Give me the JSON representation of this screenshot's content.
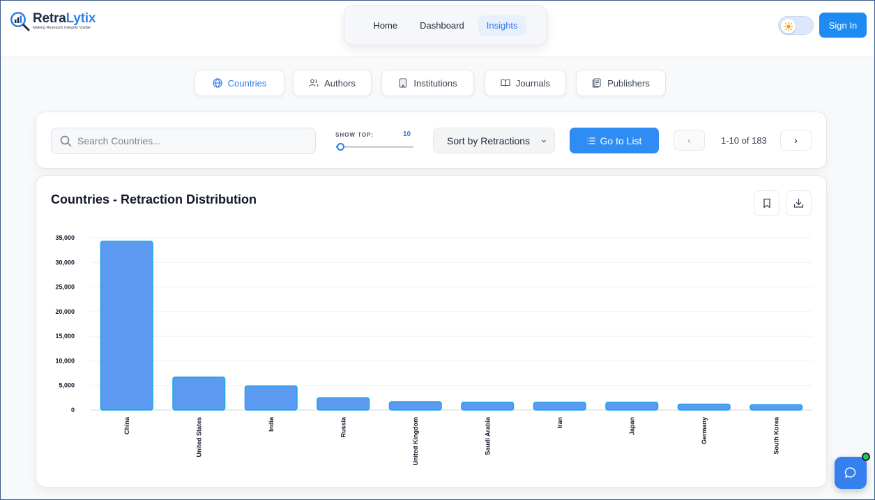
{
  "app": {
    "name_part1": "Retra",
    "name_part2": "Lytix",
    "tagline": "Making Research Integrity Visible"
  },
  "nav": {
    "items": [
      {
        "label": "Home"
      },
      {
        "label": "Dashboard"
      },
      {
        "label": "Insights",
        "active": true
      }
    ]
  },
  "header": {
    "sign_in_label": "Sign In",
    "theme_icon": "sun-icon"
  },
  "tabs": [
    {
      "label": "Countries",
      "icon": "globe-icon",
      "active": true
    },
    {
      "label": "Authors",
      "icon": "users-icon"
    },
    {
      "label": "Institutions",
      "icon": "building-icon"
    },
    {
      "label": "Journals",
      "icon": "book-open-icon"
    },
    {
      "label": "Publishers",
      "icon": "publisher-icon"
    }
  ],
  "controls": {
    "search_placeholder": "Search Countries...",
    "search_value": "",
    "show_top_label": "SHOW TOP:",
    "show_top_value": "10",
    "show_top_fraction": 0.05,
    "sort_label": "Sort by Retractions",
    "go_to_list_label": "Go to List",
    "pagination_info": "1-10 of 183",
    "prev_label": "‹",
    "next_label": "›"
  },
  "colors": {
    "accent": "#2f7be8",
    "bar_fill": "#5b9af0",
    "bar_stroke": "#19a6e8",
    "sign_in": "#1d8bf1"
  },
  "chart_data": {
    "type": "bar",
    "title": "Countries - Retraction Distribution",
    "categories": [
      "China",
      "United States",
      "India",
      "Russia",
      "United Kingdom",
      "Saudi Arabia",
      "Iran",
      "Japan",
      "Germany",
      "South Korea"
    ],
    "values": [
      34300,
      6700,
      4900,
      2500,
      1700,
      1600,
      1600,
      1600,
      1200,
      1100
    ],
    "ylim": [
      0,
      35000
    ],
    "yticks": [
      "0",
      "5,000",
      "10,000",
      "15,000",
      "20,000",
      "25,000",
      "30,000",
      "35,000"
    ],
    "ytick_values": [
      0,
      5000,
      10000,
      15000,
      20000,
      25000,
      30000,
      35000
    ],
    "grid": true,
    "xlabel": "",
    "ylabel": ""
  }
}
